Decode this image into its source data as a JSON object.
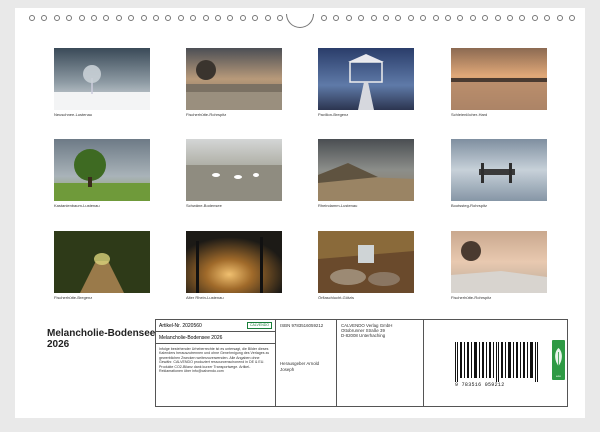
{
  "photos": [
    {
      "caption": "Neuschnee-Lustenau"
    },
    {
      "caption": "Fischerhütte-Rohrspitz"
    },
    {
      "caption": "Pavillon-Bregenz"
    },
    {
      "caption": "Schleienlöcher-Hard"
    },
    {
      "caption": "Kastanienbaum-Lustenau"
    },
    {
      "caption": "Schwäne-Bodensee"
    },
    {
      "caption": "Rheindamm-Lustenau"
    },
    {
      "caption": "Bootssteg-Rohrspitz"
    },
    {
      "caption": "Fischerhütte-Bregenz"
    },
    {
      "caption": "Alter Rhein-Lustenau"
    },
    {
      "caption": "Örflaschlucht-Götzis"
    },
    {
      "caption": "Fischerhütte-Rohrspitz"
    }
  ],
  "calendar": {
    "title": "Melancholie-Bodensee 2026"
  },
  "info": {
    "artnr": "Artikel-Nr. 2020560",
    "badge": "CALVENDO",
    "name": "Melancholie-Bodensee 2026",
    "description": "Infolge bestehender Urheberrechte ist es untersagt, die Bilder dieses Kalenders herauszutrennen und ohne Genehmigung des Verlages zu gewerblichen Zwecken weiterzuverwenden. Alle Angaben ohne Gewähr. CALVENDO produziert ressourcenschonend in DE & EU. Produkte CO2-Bilanz dank kurzer Transportwege. Artikel-Reklamationen über info@calvendo.com",
    "isbn": "ISBN 9783516059212",
    "publisher_line1": "CALVENDO Verlag GmbH",
    "publisher_line2": "Ottobrunner Straße 39",
    "publisher_line3": "D-82008 Unterhaching",
    "editor": "Herausgeber Arnold Joseph",
    "barcode_number": "9 783516 059212",
    "eco_label": "eco"
  }
}
